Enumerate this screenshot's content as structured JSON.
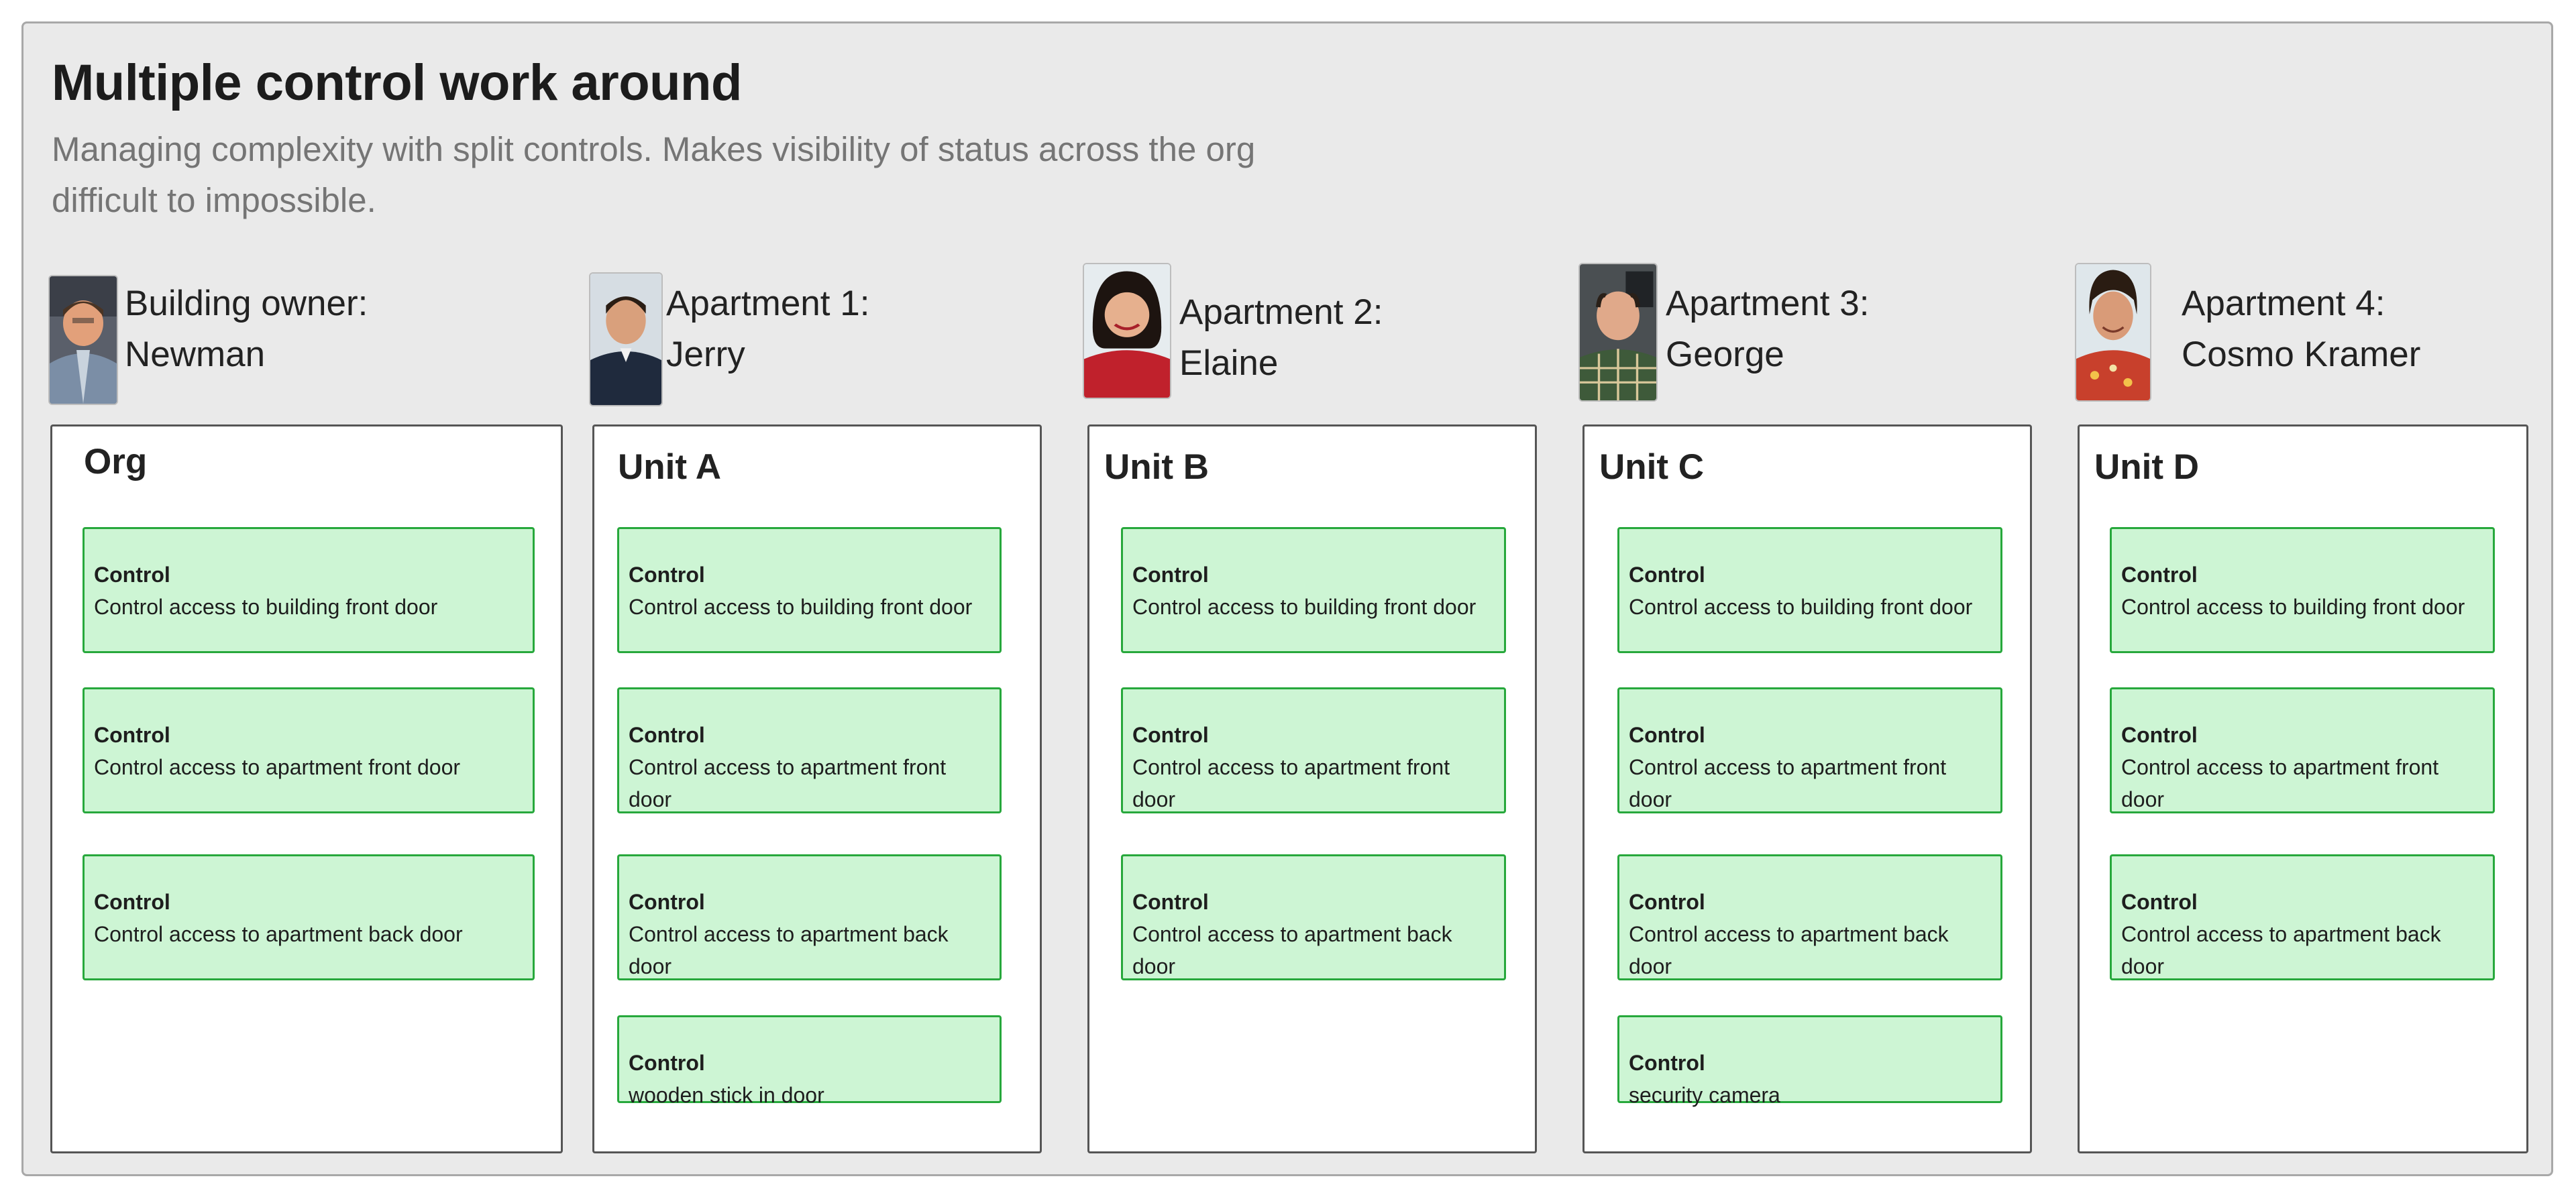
{
  "header": {
    "title": "Multiple control work around",
    "subtitle": "Managing complexity with split controls. Makes visibility of status across the org difficult to impossible."
  },
  "people": [
    {
      "role": "Building owner:",
      "name": "Newman"
    },
    {
      "role": "Apartment 1:",
      "name": "Jerry"
    },
    {
      "role": "Apartment 2:",
      "name": "Elaine"
    },
    {
      "role": "Apartment 3:",
      "name": "George"
    },
    {
      "role": "Apartment 4:",
      "name": "Cosmo Kramer"
    }
  ],
  "units": [
    {
      "title": "Org",
      "controls": [
        {
          "label": "Control",
          "text": "Control access to building front door"
        },
        {
          "label": "Control",
          "text": "Control access to apartment front door"
        },
        {
          "label": "Control",
          "text": "Control access to apartment back door"
        }
      ]
    },
    {
      "title": "Unit A",
      "controls": [
        {
          "label": "Control",
          "text": "Control access to building front door"
        },
        {
          "label": "Control",
          "text": "Control access to apartment front door"
        },
        {
          "label": "Control",
          "text": "Control access to apartment back door"
        },
        {
          "label": "Control",
          "text": "wooden stick in door"
        }
      ]
    },
    {
      "title": "Unit B",
      "controls": [
        {
          "label": "Control",
          "text": "Control access to building front door"
        },
        {
          "label": "Control",
          "text": "Control access to apartment front door"
        },
        {
          "label": "Control",
          "text": "Control access to apartment back door"
        }
      ]
    },
    {
      "title": "Unit C",
      "controls": [
        {
          "label": "Control",
          "text": "Control access to building front door"
        },
        {
          "label": "Control",
          "text": "Control access to apartment front door"
        },
        {
          "label": "Control",
          "text": "Control access to apartment back door"
        },
        {
          "label": "Control",
          "text": "security camera"
        }
      ]
    },
    {
      "title": "Unit D",
      "controls": [
        {
          "label": "Control",
          "text": "Control access to building front door"
        },
        {
          "label": "Control",
          "text": "Control access to apartment front door"
        },
        {
          "label": "Control",
          "text": "Control access to apartment back door"
        }
      ]
    }
  ],
  "colors": {
    "board_background": "#eaeaea",
    "card_fill": "#cdf5d4",
    "card_border": "#27a83c",
    "unit_border": "#555555",
    "subtitle_text": "#757575"
  },
  "icons": [
    "newman-photo-icon",
    "jerry-photo-icon",
    "elaine-photo-icon",
    "george-photo-icon",
    "kramer-photo-icon"
  ]
}
